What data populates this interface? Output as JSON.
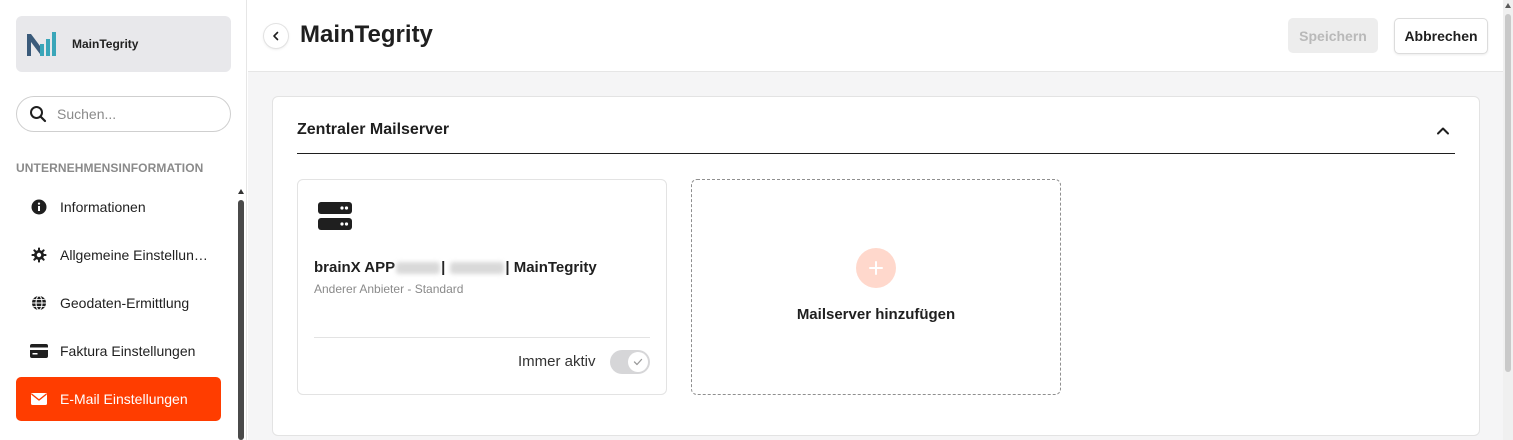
{
  "sidebar": {
    "brand": {
      "name": "MainTegrity",
      "logo_icon": "maintegrity-logo-icon"
    },
    "search": {
      "placeholder": "Suchen...",
      "value": "",
      "icon": "search-icon"
    },
    "section_label": "UNTERNEHMENSINFORMATION",
    "items": [
      {
        "label": "Informationen",
        "icon": "info-icon",
        "active": false
      },
      {
        "label": "Allgemeine Einstellungen",
        "icon": "gear-icon",
        "active": false
      },
      {
        "label": "Geodaten-Ermittlung",
        "icon": "globe-icon",
        "active": false
      },
      {
        "label": "Faktura Einstellungen",
        "icon": "credit-card-icon",
        "active": false
      },
      {
        "label": "E-Mail Einstellungen",
        "icon": "envelope-icon",
        "active": true
      }
    ]
  },
  "header": {
    "title": "MainTegrity",
    "save_label": "Speichern",
    "save_enabled": false,
    "cancel_label": "Abbrechen"
  },
  "main": {
    "section": {
      "title": "Zentraler Mailserver",
      "expanded": true
    },
    "server_card": {
      "icon": "server-icon",
      "title_prefix": "brainX APP",
      "title_sep1": "|",
      "title_sep2": "| MainTegrity",
      "subtitle": "Anderer Anbieter - Standard",
      "toggle_label": "Immer aktiv",
      "toggle_on": true
    },
    "add_card": {
      "label": "Mailserver hinzufügen",
      "icon": "plus-icon"
    }
  },
  "colors": {
    "accent": "#ff3d00",
    "accent_light": "#ffd8cc",
    "logo_teal": "#3aa6b9"
  }
}
